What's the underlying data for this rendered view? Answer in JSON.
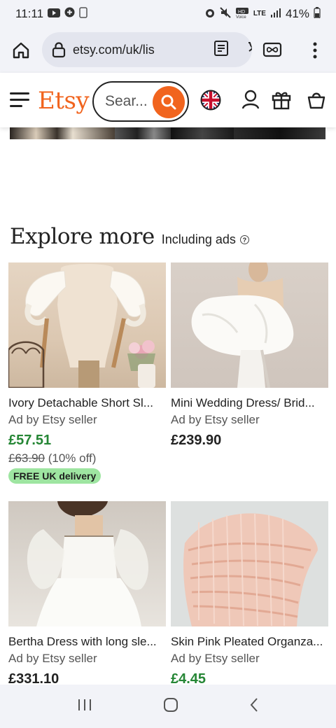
{
  "status_bar": {
    "time": "11:11",
    "battery": "41%",
    "network": "LTE"
  },
  "browser": {
    "url": "etsy.com/uk/lis",
    "icons": [
      "home-icon",
      "lock-icon",
      "reader-icon",
      "translate-icon",
      "tabs-icon",
      "more-vert-icon"
    ]
  },
  "header": {
    "logo": "Etsy",
    "search_placeholder": "Sear...",
    "icons": [
      "menu-icon",
      "search-icon",
      "uk-flag-icon",
      "account-icon",
      "gift-icon",
      "basket-icon"
    ]
  },
  "explore": {
    "title": "Explore more",
    "subtitle": "Including ads"
  },
  "listings": [
    {
      "title": "Ivory Detachable Short Sl...",
      "ad_label": "Ad by Etsy seller",
      "price": "£57.51",
      "original_price": "£63.90",
      "discount": "(10% off)",
      "delivery_badge": "FREE UK delivery"
    },
    {
      "title": "Mini Wedding Dress/ Brid...",
      "ad_label": "Ad by Etsy seller",
      "price": "£239.90"
    },
    {
      "title": "Bertha Dress with long sle...",
      "ad_label": "Ad by Etsy seller",
      "price": "£331.10"
    },
    {
      "title": "Skin Pink Pleated Organza...",
      "ad_label": "Ad by Etsy seller",
      "price": "£4.45"
    }
  ],
  "colors": {
    "brand": "#f1641e",
    "sale_price": "#258635",
    "delivery_badge": "#9ee5a1"
  }
}
